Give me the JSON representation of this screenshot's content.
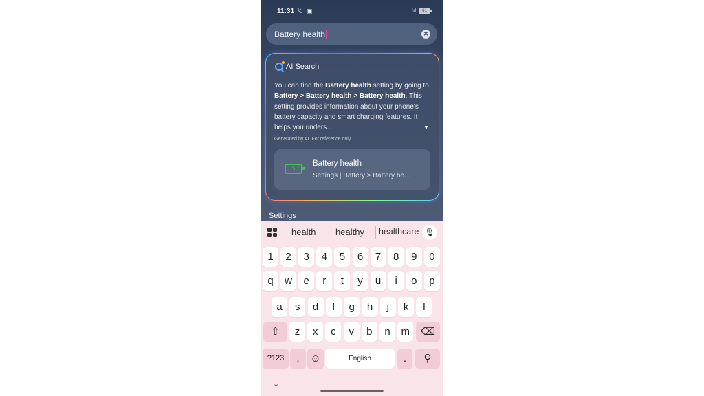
{
  "status_bar": {
    "time": "11:31",
    "left_icons": "𝕏 ▣",
    "battery": "61"
  },
  "search": {
    "query": "Battery health"
  },
  "ai_card": {
    "title": "AI Search",
    "answer": {
      "p1": "You can find the ",
      "b1": "Battery health",
      "p2": " setting by going to ",
      "b2": "Battery > Battery health > Battery health",
      "p3": ". This setting provides information about your phone's battery capacity and smart charging features. It helps you unders..."
    },
    "footnote": "Generated by AI. For reference only.",
    "result": {
      "title": "Battery health",
      "path": "Settings | Battery > Battery he..."
    }
  },
  "section_label": "Settings",
  "keyboard": {
    "suggestions": [
      "health",
      "healthy",
      "healthcare"
    ],
    "row_numbers": [
      "1",
      "2",
      "3",
      "4",
      "5",
      "6",
      "7",
      "8",
      "9",
      "0"
    ],
    "row1": [
      "q",
      "w",
      "e",
      "r",
      "t",
      "y",
      "u",
      "i",
      "o",
      "p"
    ],
    "row2": [
      "a",
      "s",
      "d",
      "f",
      "g",
      "h",
      "j",
      "k",
      "l"
    ],
    "row3": [
      "z",
      "x",
      "c",
      "v",
      "b",
      "n",
      "m"
    ],
    "symbols_label": "?123",
    "comma": ",",
    "period": ".",
    "space_label": "English"
  }
}
